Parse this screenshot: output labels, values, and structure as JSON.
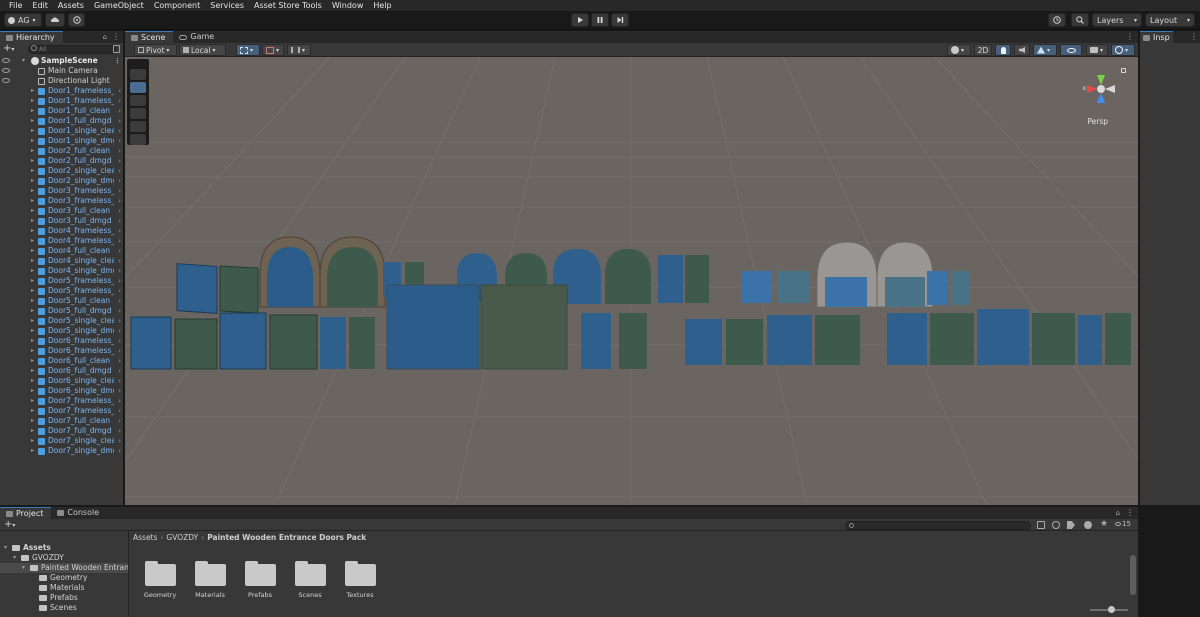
{
  "menu": [
    "File",
    "Edit",
    "Assets",
    "GameObject",
    "Component",
    "Services",
    "Asset Store Tools",
    "Window",
    "Help"
  ],
  "toolbar": {
    "account": "AG",
    "layers_label": "Layers",
    "layout_label": "Layout"
  },
  "hierarchy": {
    "tab_label": "Hierarchy",
    "search_placeholder": "All",
    "scene_name": "SampleScene",
    "items": [
      {
        "label": "Main Camera",
        "prefab": false
      },
      {
        "label": "Directional Light",
        "prefab": false
      },
      {
        "label": "Door1_frameless_c",
        "prefab": true
      },
      {
        "label": "Door1_frameless_c",
        "prefab": true
      },
      {
        "label": "Door1_full_clean",
        "prefab": true
      },
      {
        "label": "Door1_full_dmgd",
        "prefab": true
      },
      {
        "label": "Door1_single_clea",
        "prefab": true
      },
      {
        "label": "Door1_single_dmg",
        "prefab": true
      },
      {
        "label": "Door2_full_clean",
        "prefab": true
      },
      {
        "label": "Door2_full_dmgd",
        "prefab": true
      },
      {
        "label": "Door2_single_clea",
        "prefab": true
      },
      {
        "label": "Door2_single_dmg",
        "prefab": true
      },
      {
        "label": "Door3_frameless_c",
        "prefab": true
      },
      {
        "label": "Door3_frameless_c",
        "prefab": true
      },
      {
        "label": "Door3_full_clean",
        "prefab": true
      },
      {
        "label": "Door3_full_dmgd",
        "prefab": true
      },
      {
        "label": "Door4_frameless_c",
        "prefab": true
      },
      {
        "label": "Door4_frameless_c",
        "prefab": true
      },
      {
        "label": "Door4_full_clean",
        "prefab": true
      },
      {
        "label": "Door4_single_clea",
        "prefab": true
      },
      {
        "label": "Door4_single_dmg",
        "prefab": true
      },
      {
        "label": "Door5_frameless_c",
        "prefab": true
      },
      {
        "label": "Door5_frameless_c",
        "prefab": true
      },
      {
        "label": "Door5_full_clean",
        "prefab": true
      },
      {
        "label": "Door5_full_dmgd",
        "prefab": true
      },
      {
        "label": "Door5_single_clea",
        "prefab": true
      },
      {
        "label": "Door5_single_dmg",
        "prefab": true
      },
      {
        "label": "Door6_frameless_c",
        "prefab": true
      },
      {
        "label": "Door6_frameless_c",
        "prefab": true
      },
      {
        "label": "Door6_full_clean",
        "prefab": true
      },
      {
        "label": "Door6_full_dmgd",
        "prefab": true
      },
      {
        "label": "Door6_single_clea",
        "prefab": true
      },
      {
        "label": "Door6_single_dmg",
        "prefab": true
      },
      {
        "label": "Door7_frameless_c",
        "prefab": true
      },
      {
        "label": "Door7_frameless_c",
        "prefab": true
      },
      {
        "label": "Door7_full_clean",
        "prefab": true
      },
      {
        "label": "Door7_full_dmgd",
        "prefab": true
      },
      {
        "label": "Door7_single_clea",
        "prefab": true
      },
      {
        "label": "Door7_single_dmg",
        "prefab": true
      }
    ]
  },
  "scene": {
    "tabs": [
      "Scene",
      "Game"
    ],
    "pivot_label": "Pivot",
    "local_label": "Local",
    "mode_2d": "2D",
    "gizmo_axis": "x",
    "projection": "Persp"
  },
  "inspector": {
    "tab_label": "Insp"
  },
  "project": {
    "tabs": [
      "Project",
      "Console"
    ],
    "zoom_count": "15",
    "tree": [
      {
        "label": "Assets",
        "level": 0,
        "bold": true
      },
      {
        "label": "GVOZDY",
        "level": 1,
        "bold": false
      },
      {
        "label": "Painted Wooden Entran",
        "level": 2,
        "bold": false
      },
      {
        "label": "Geometry",
        "level": 3,
        "bold": false
      },
      {
        "label": "Materials",
        "level": 3,
        "bold": false
      },
      {
        "label": "Prefabs",
        "level": 3,
        "bold": false
      },
      {
        "label": "Scenes",
        "level": 3,
        "bold": false
      }
    ],
    "breadcrumb": [
      "Assets",
      "GVOZDY",
      "Painted Wooden Entrance Doors Pack"
    ],
    "folders": [
      "Geometry",
      "Materials",
      "Prefabs",
      "Scenes",
      "Textures"
    ]
  },
  "colors": {
    "accent": "#3a79bb",
    "prefab_text": "#7cb6f2",
    "door_blue": "#2f5f8c",
    "door_green": "#3d5a4c",
    "viewport_bg": "#6b6562"
  }
}
